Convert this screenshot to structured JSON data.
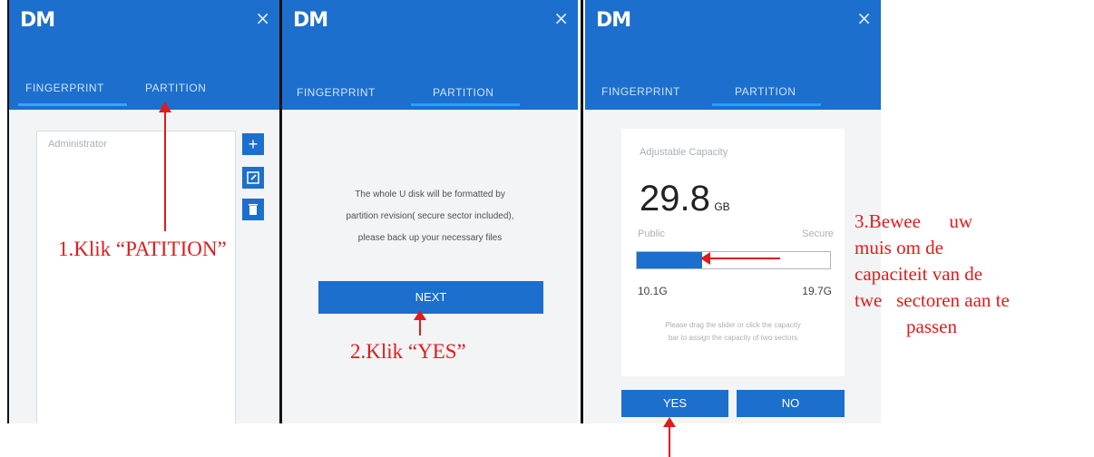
{
  "panels": [
    {
      "logo": "DM",
      "close": "×",
      "tabs": [
        "FINGERPRINT",
        "PARTITION"
      ],
      "list_placeholder": "Administrator"
    },
    {
      "logo": "DM",
      "close": "×",
      "tabs": [
        "FINGERPRINT",
        "PARTITION"
      ],
      "message_line1": "The whole U disk will be formatted by",
      "message_line2": "partition revision( secure sector included),",
      "message_line3": "please back up your necessary files",
      "next_label": "NEXT"
    },
    {
      "logo": "DM",
      "close": "×",
      "tabs": [
        "FINGERPRINT",
        "PARTITION"
      ],
      "capacity_label": "Adjustable Capacity",
      "capacity_value": "29.8",
      "capacity_unit": "GB",
      "public_label": "Public",
      "secure_label": "Secure",
      "public_value": "10.1G",
      "secure_value": "19.7G",
      "hint_line1": "Please drag the slider or click the capacity",
      "hint_line2": "bar to assign the capacity of two sectors",
      "yes_label": "YES",
      "no_label": "NO",
      "public_fraction": 0.339
    }
  ],
  "annotations": {
    "step1": "1.Klik “PATITION”",
    "step2": "2.Klik “YES”",
    "step3_line1": "3.Bewee      uw",
    "step3_line2": "muis om de",
    "step3_line3": "capaciteit van de",
    "step3_line4": "twe   sectoren aan te",
    "step3_line5": "passen"
  }
}
